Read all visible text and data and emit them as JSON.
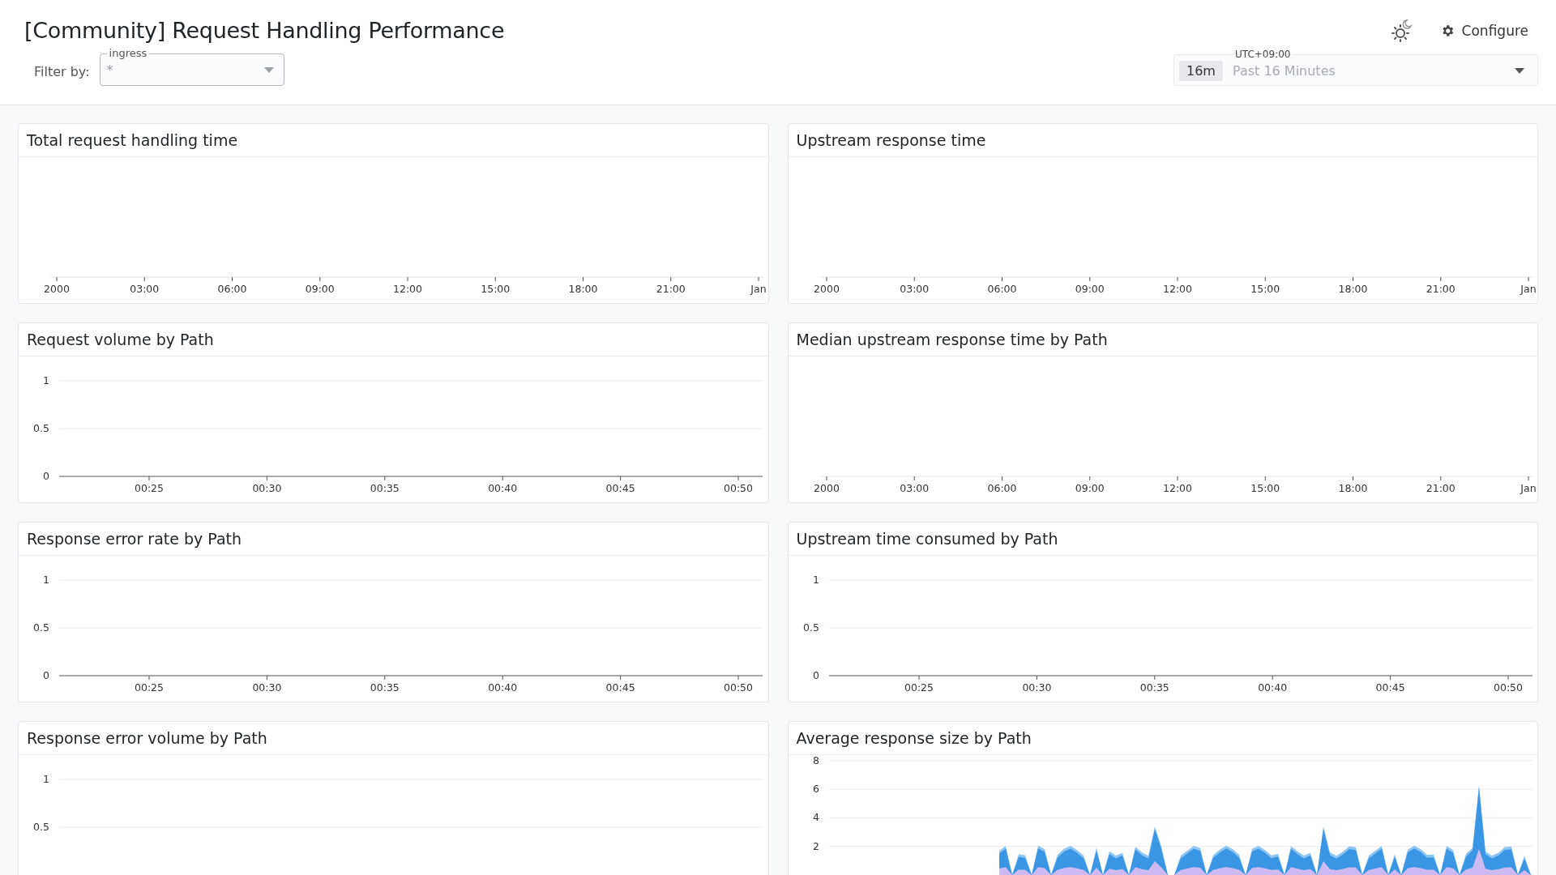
{
  "header": {
    "title": "[Community] Request Handling Performance",
    "configure_button": "Configure"
  },
  "filter": {
    "label": "Filter by:",
    "legend": "ingress",
    "value": "*"
  },
  "time_picker": {
    "timezone": "UTC+09:00",
    "badge": "16m",
    "range": "Past 16 Minutes"
  },
  "panels": [
    {
      "title": "Total request handling time",
      "kind": "line",
      "x_axis_labels": [
        "2000",
        "03:00",
        "06:00",
        "09:00",
        "12:00",
        "15:00",
        "18:00",
        "21:00",
        "Jan"
      ]
    },
    {
      "title": "Upstream response time",
      "kind": "line",
      "x_axis_labels": [
        "2000",
        "03:00",
        "06:00",
        "09:00",
        "12:00",
        "15:00",
        "18:00",
        "21:00",
        "Jan"
      ]
    },
    {
      "title": "Request volume by Path",
      "kind": "line",
      "x_axis_labels": [
        "00:25",
        "00:30",
        "00:35",
        "00:40",
        "00:45",
        "00:50"
      ],
      "y_axis_labels": [
        "1",
        "0.5",
        "0"
      ]
    },
    {
      "title": "Median upstream response time by Path",
      "kind": "line",
      "x_axis_labels": [
        "2000",
        "03:00",
        "06:00",
        "09:00",
        "12:00",
        "15:00",
        "18:00",
        "21:00",
        "Jan"
      ]
    },
    {
      "title": "Response error rate by Path",
      "kind": "line",
      "x_axis_labels": [
        "00:25",
        "00:30",
        "00:35",
        "00:40",
        "00:45",
        "00:50"
      ],
      "y_axis_labels": [
        "1",
        "0.5",
        "0"
      ]
    },
    {
      "title": "Upstream time consumed by Path",
      "kind": "line",
      "x_axis_labels": [
        "00:25",
        "00:30",
        "00:35",
        "00:40",
        "00:45",
        "00:50"
      ],
      "y_axis_labels": [
        "1",
        "0.5",
        "0"
      ]
    },
    {
      "title": "Response error volume by Path",
      "kind": "line",
      "y_axis_labels": [
        "1",
        "0.5"
      ]
    },
    {
      "title": "Average response size by Path",
      "kind": "area",
      "y_axis_labels": [
        "8",
        "6",
        "4",
        "2"
      ]
    }
  ]
}
